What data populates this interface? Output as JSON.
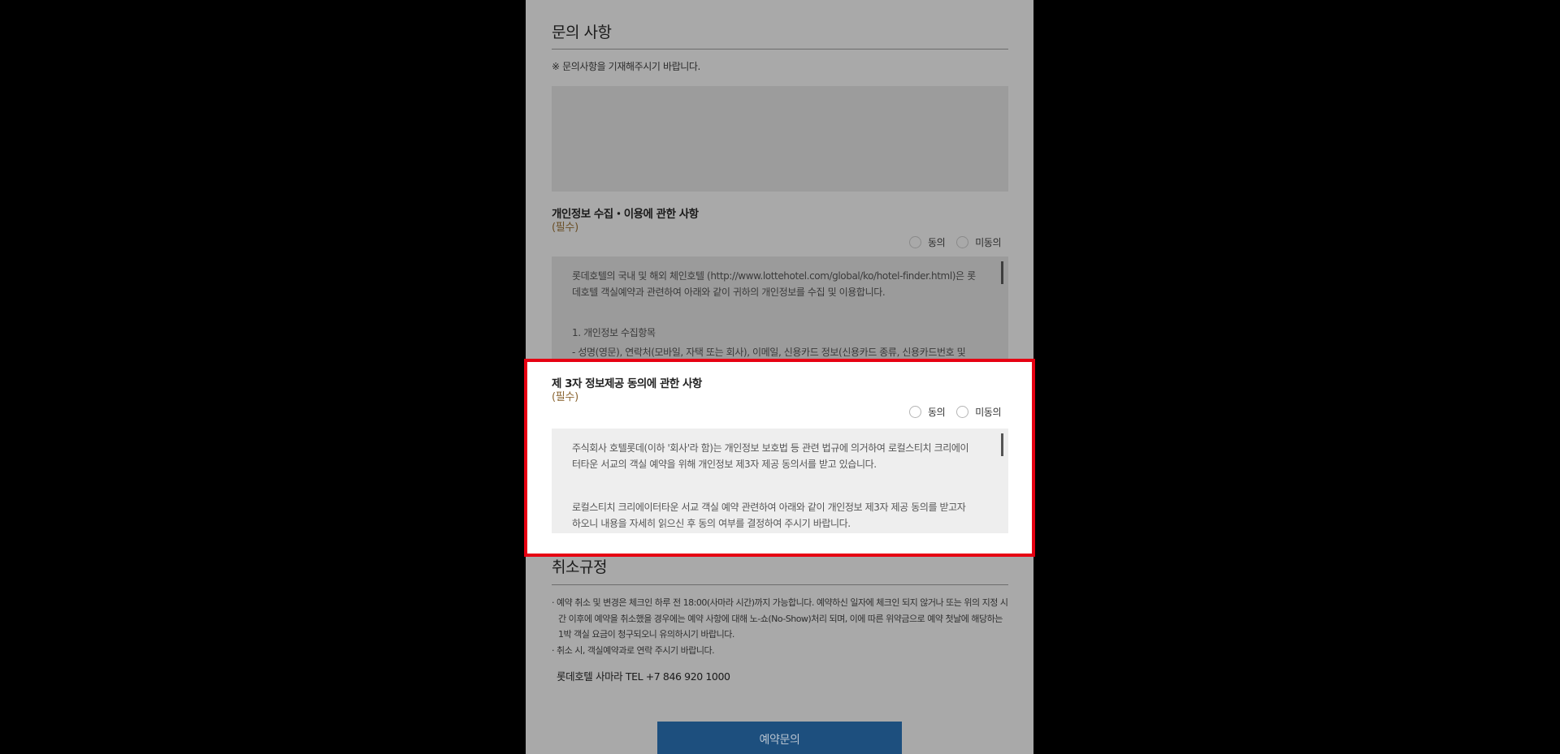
{
  "inquiry": {
    "title": "문의 사항",
    "note": "※ 문의사항을 기재해주시기 바랍니다.",
    "textarea_value": ""
  },
  "privacy": {
    "title": "개인정보 수집・이용에 관한 사항",
    "required": "(필수)",
    "agree": "동의",
    "disagree": "미동의",
    "paragraphs": [
      "롯데호텔의 국내 및 해외 체인호텔 (http://www.lottehotel.com/global/ko/hotel-finder.html)은 롯데호텔 객실예약과 관련하여 아래와 같이 귀하의 개인정보를 수집 및 이용합니다.",
      "1. 개인정보 수집항목",
      "- 성명(영문), 연락처(모바일, 자택 또는 회사), 이메일, 신용카드 정보(신용카드 종류, 신용카드번호 및"
    ]
  },
  "third_party": {
    "title": "제 3자 정보제공 동의에 관한 사항",
    "required": "(필수)",
    "agree": "동의",
    "disagree": "미동의",
    "paragraphs": [
      "주식회사 호텔롯데(이하 '회사'라 함)는 개인정보 보호법 등 관련 법규에 의거하여 로컬스티치 크리에이터타운 서교의 객실 예약을 위해 개인정보 제3자 제공 동의서를 받고 있습니다.",
      "로컬스티치 크리에이터타운 서교 객실 예약 관련하여 아래와 같이 개인정보 제3자 제공 동의를 받고자 하오니 내용을 자세히 읽으신 후 동의 여부를 결정하여 주시기 바랍니다."
    ]
  },
  "cancel": {
    "title": "취소규정",
    "items": [
      "· 예약 취소 및 변경은 체크인 하루 전 18:00(사마라 시간)까지 가능합니다. 예약하신 일자에 체크인 되지 않거나 또는 위의 지정 시간 이후에 예약을 취소했을 경우에는 예약 사항에 대해 노-쇼(No-Show)처리 되며, 이에 따른 위약금으로 예약 첫날에 해당하는 1박 객실 요금이 청구되오니 유의하시기 바랍니다.",
      "· 취소 시, 객실예약과로 연락 주시기 바랍니다."
    ],
    "tel": "롯데호텔 사마라 TEL +7 846 920 1000"
  },
  "submit_label": "예약문의",
  "colors": {
    "highlight_border": "#e60012",
    "button_bg": "#1d4f7e",
    "required_text": "#8a6531"
  }
}
